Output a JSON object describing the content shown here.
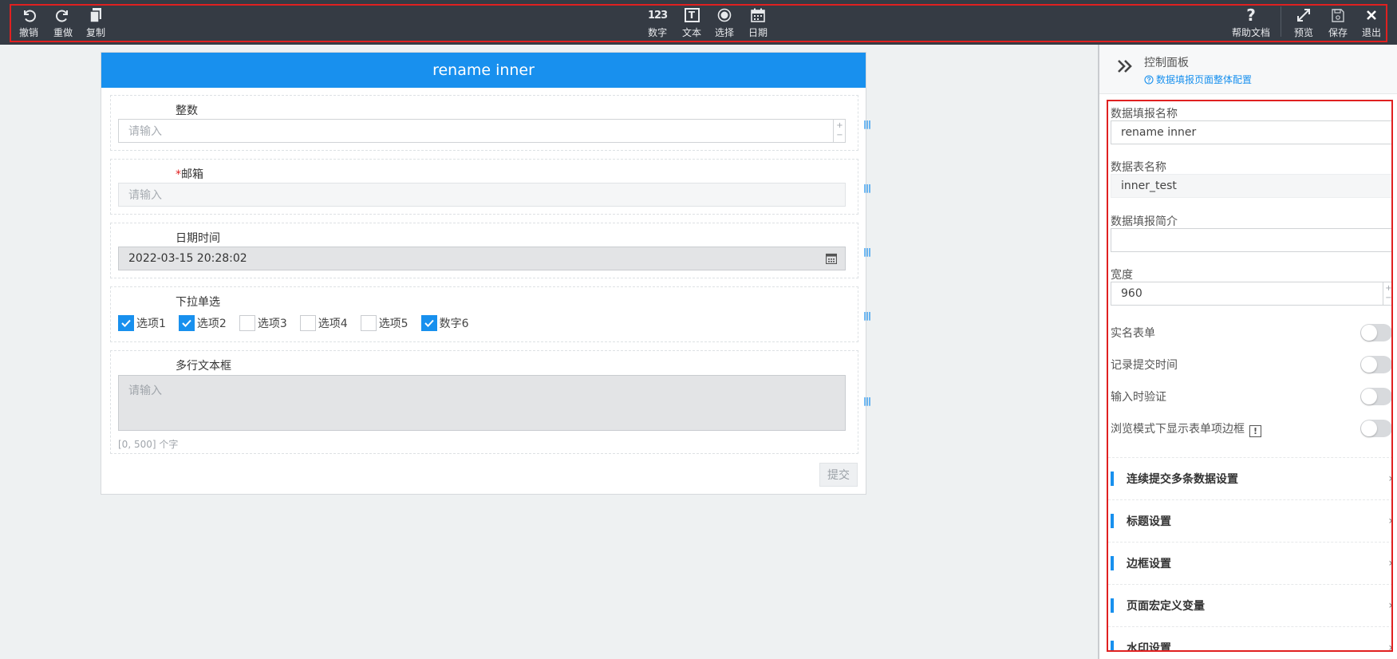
{
  "toolbar": {
    "undo_label": "撤销",
    "redo_label": "重做",
    "copy_label": "复制",
    "number_label": "数字",
    "text_label": "文本",
    "select_label": "选择",
    "date_label": "日期",
    "help_label": "帮助文档",
    "preview_label": "预览",
    "save_label": "保存",
    "exit_label": "退出",
    "number_icon_text": "123",
    "text_icon_text": "T"
  },
  "form": {
    "title": "rename inner",
    "fields": {
      "integer": {
        "label": "整数",
        "placeholder": "请输入"
      },
      "email": {
        "required_mark": "*",
        "label": "邮箱",
        "placeholder": "请输入"
      },
      "datetime": {
        "label": "日期时间",
        "value": "2022-03-15 20:28:02"
      },
      "dropdown": {
        "label": "下拉单选",
        "options": [
          {
            "label": "选项1",
            "checked": true
          },
          {
            "label": "选项2",
            "checked": true
          },
          {
            "label": "选项3",
            "checked": false
          },
          {
            "label": "选项4",
            "checked": false
          },
          {
            "label": "选项5",
            "checked": false
          },
          {
            "label": "数字6",
            "checked": true
          }
        ]
      },
      "textarea": {
        "label": "多行文本框",
        "placeholder": "请输入",
        "counter": "[0, 500] 个字"
      }
    },
    "submit_label": "提交"
  },
  "panel": {
    "title": "控制面板",
    "config_link": "数据填报页面整体配置",
    "form_name_label": "数据填报名称",
    "form_name_value": "rename inner",
    "table_name_label": "数据表名称",
    "table_name_value": "inner_test",
    "intro_label": "数据填报简介",
    "intro_value": "",
    "width_label": "宽度",
    "width_value": "960",
    "toggles": [
      {
        "label": "实名表单",
        "on": false
      },
      {
        "label": "记录提交时间",
        "on": false
      },
      {
        "label": "输入时验证",
        "on": false
      },
      {
        "label": "浏览模式下显示表单项边框",
        "on": false
      }
    ],
    "sections": [
      "连续提交多条数据设置",
      "标题设置",
      "边框设置",
      "页面宏定义变量",
      "水印设置"
    ]
  },
  "colors": {
    "accent": "#1890ee",
    "toolbar_bg": "#353b44",
    "highlight_frame": "#e02020"
  }
}
